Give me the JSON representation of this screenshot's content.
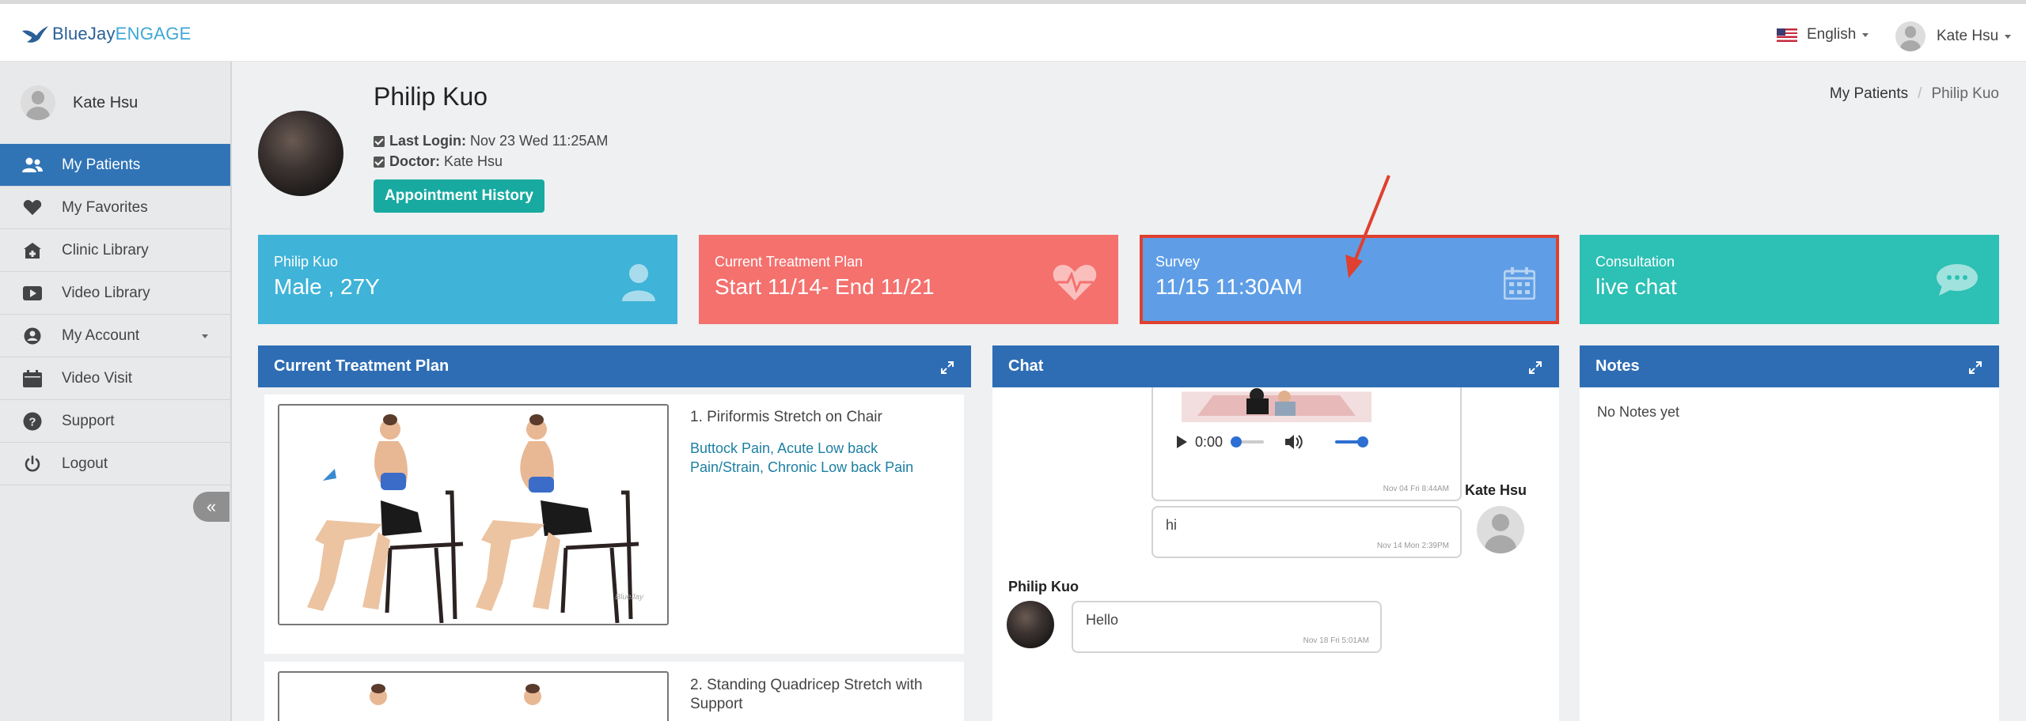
{
  "brand": {
    "part1": "BlueJay",
    "part2": "ENGAGE"
  },
  "topbar": {
    "language": "English",
    "user_name": "Kate Hsu"
  },
  "sidebar": {
    "user_name": "Kate Hsu",
    "items": [
      {
        "label": "My Patients",
        "icon": "users-icon",
        "active": true
      },
      {
        "label": "My Favorites",
        "icon": "heart-icon"
      },
      {
        "label": "Clinic Library",
        "icon": "clinic-icon"
      },
      {
        "label": "Video Library",
        "icon": "video-icon"
      },
      {
        "label": "My Account",
        "icon": "account-icon"
      },
      {
        "label": "Video Visit",
        "icon": "calendar-icon"
      },
      {
        "label": "Support",
        "icon": "question-icon"
      },
      {
        "label": "Logout",
        "icon": "power-icon"
      }
    ],
    "collapse_glyph": "«"
  },
  "patient": {
    "name": "Philip Kuo",
    "last_login_label": "Last Login:",
    "last_login": "Nov 23 Wed 11:25AM",
    "doctor_label": "Doctor:",
    "doctor": "Kate Hsu",
    "appointment_button": "Appointment History"
  },
  "breadcrumb": {
    "parent": "My Patients",
    "separator": "/",
    "current": "Philip Kuo"
  },
  "cards": [
    {
      "label": "Philip Kuo",
      "value": "Male , 27Y",
      "icon": "user-icon",
      "color": "#3fb3d8"
    },
    {
      "label": "Current Treatment Plan",
      "value": "Start 11/14- End 11/21",
      "icon": "heartbeat-icon",
      "color": "#f4716e"
    },
    {
      "label": "Survey",
      "value": "11/15 11:30AM",
      "icon": "calendar-icon",
      "color": "#5f9ee6"
    },
    {
      "label": "Consultation",
      "value": "live chat",
      "icon": "chat-bubble-icon",
      "color": "#2dc0b4"
    }
  ],
  "treatment_panel": {
    "title": "Current Treatment Plan",
    "exercises": [
      {
        "title": "1. Piriformis Stretch on Chair",
        "tags": "Buttock Pain, Acute Low back Pain/Strain, Chronic Low back Pain",
        "watermark": "BlueJay"
      },
      {
        "title": "2. Standing Quadricep Stretch with Support"
      }
    ]
  },
  "chat_panel": {
    "title": "Chat",
    "media": {
      "time": "0:00",
      "timestamp": "Nov 04 Fri 8:44AM"
    },
    "messages": [
      {
        "sender": "Kate Hsu",
        "text": "hi",
        "timestamp": "Nov 14 Mon 2:39PM"
      },
      {
        "sender": "Philip Kuo",
        "text": "Hello",
        "timestamp": "Nov 18 Fri 5:01AM"
      }
    ]
  },
  "notes_panel": {
    "title": "Notes",
    "empty_text": "No Notes yet"
  },
  "colors": {
    "primary": "#2e6db4",
    "accent_teal": "#18aaa0",
    "highlight": "#e0402f"
  }
}
